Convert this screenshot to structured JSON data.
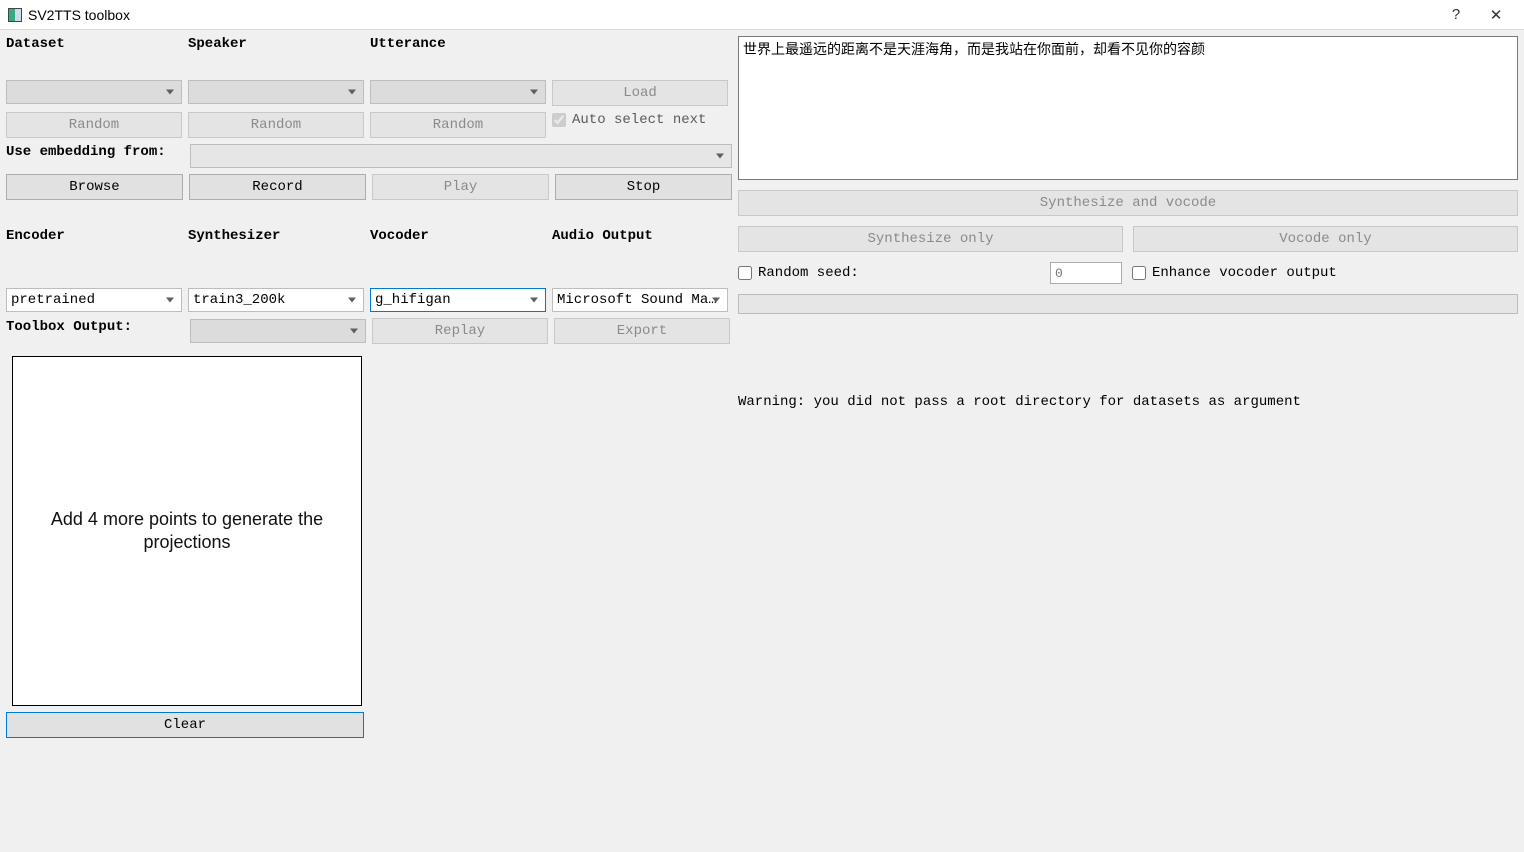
{
  "window": {
    "title": "SV2TTS toolbox"
  },
  "headings": {
    "dataset": "Dataset",
    "speaker": "Speaker",
    "utterance": "Utterance",
    "use_embedding": "Use embedding from:",
    "encoder": "Encoder",
    "synthesizer": "Synthesizer",
    "vocoder": "Vocoder",
    "audio_output": "Audio Output",
    "toolbox_output": "Toolbox Output:"
  },
  "buttons": {
    "load": "Load",
    "random": "Random",
    "browse": "Browse",
    "record": "Record",
    "play": "Play",
    "stop": "Stop",
    "replay": "Replay",
    "export": "Export",
    "clear": "Clear",
    "synth_vocode": "Synthesize and vocode",
    "synth_only": "Synthesize only",
    "vocode_only": "Vocode only"
  },
  "checkboxes": {
    "auto_select_next": "Auto select next",
    "random_seed": "Random seed:",
    "enhance_vocoder": "Enhance vocoder output"
  },
  "selects": {
    "dataset": "",
    "speaker": "",
    "utterance": "",
    "embedding": "",
    "encoder": "pretrained",
    "synthesizer": "train3_200k",
    "vocoder": "g_hifigan",
    "audio_output": "Microsoft Sound Mapper",
    "toolbox_output": ""
  },
  "inputs": {
    "text": "世界上最遥远的距离不是天涯海角，而是我站在你面前，却看不见你的容颜",
    "seed_placeholder": "0"
  },
  "plot": {
    "message": "Add 4 more points to generate the projections"
  },
  "status": {
    "warning": "Warning: you did not pass a root directory for datasets as argument"
  }
}
